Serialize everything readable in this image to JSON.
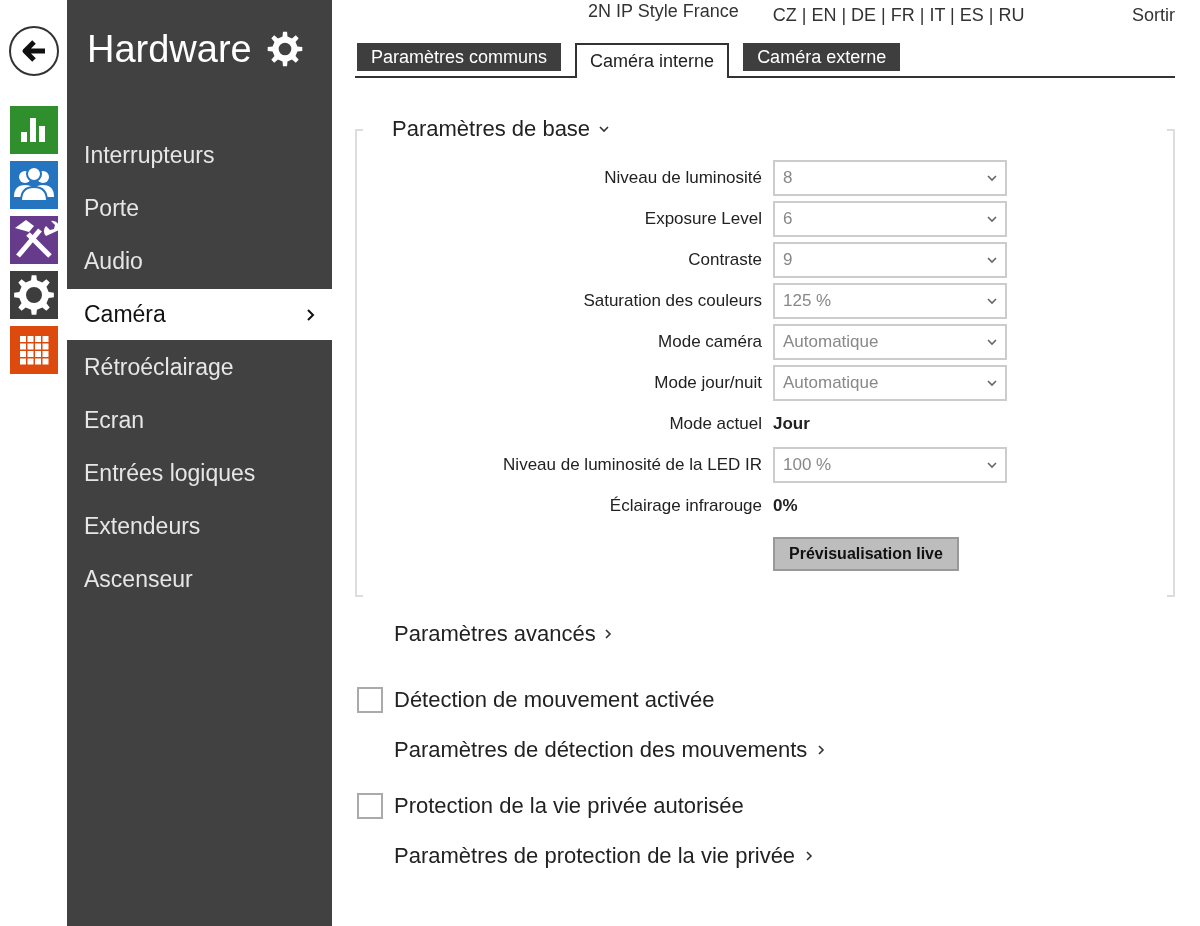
{
  "header": {
    "device_name": "2N IP Style France",
    "languages": "CZ | EN | DE | FR | IT | ES | RU",
    "logout": "Sortir"
  },
  "rail": [
    {
      "kind": "stats",
      "color": "#2f8f2c"
    },
    {
      "kind": "users",
      "color": "#2574c0"
    },
    {
      "kind": "tools",
      "color": "#663b8c"
    },
    {
      "kind": "gear",
      "color": "#3d3d3d"
    },
    {
      "kind": "grid",
      "color": "#dd4a0e"
    }
  ],
  "sidebar": {
    "title": "Hardware",
    "items": [
      {
        "label": "Interrupteurs",
        "selected": false
      },
      {
        "label": "Porte",
        "selected": false
      },
      {
        "label": "Audio",
        "selected": false
      },
      {
        "label": "Caméra",
        "selected": true
      },
      {
        "label": "Rétroéclairage",
        "selected": false
      },
      {
        "label": "Ecran",
        "selected": false
      },
      {
        "label": "Entrées logiques",
        "selected": false
      },
      {
        "label": "Extendeurs",
        "selected": false
      },
      {
        "label": "Ascenseur",
        "selected": false
      }
    ]
  },
  "tabs": [
    {
      "label": "Paramètres communs",
      "selected": false
    },
    {
      "label": "Caméra interne",
      "selected": true
    },
    {
      "label": "Caméra externe",
      "selected": false
    }
  ],
  "sections": [
    {
      "title": "Paramètres de base",
      "expanded": true,
      "fields": [
        {
          "kind": "select",
          "label": "Niveau de luminosité",
          "value": "8"
        },
        {
          "kind": "select",
          "label": "Exposure Level",
          "value": "6"
        },
        {
          "kind": "select",
          "label": "Contraste",
          "value": "9"
        },
        {
          "kind": "select",
          "label": "Saturation des couleurs",
          "value": "125 %"
        },
        {
          "kind": "select",
          "label": "Mode caméra",
          "value": "Automatique"
        },
        {
          "kind": "select",
          "label": "Mode jour/nuit",
          "value": "Automatique"
        },
        {
          "kind": "text",
          "label": "Mode actuel",
          "value": "Jour"
        },
        {
          "kind": "select",
          "label": "Niveau de luminosité de la LED IR",
          "value": "100 %"
        },
        {
          "kind": "text",
          "label": "Éclairage infrarouge",
          "value": "0%"
        },
        {
          "kind": "button",
          "label": "Prévisualisation live"
        }
      ]
    },
    {
      "title": "Paramètres avancés",
      "expanded": false
    }
  ],
  "options": [
    {
      "label": "Détection de mouvement activée",
      "checked": false,
      "link": "Paramètres de détection des mouvements"
    },
    {
      "label": "Protection de la vie privée autorisée",
      "checked": false,
      "link": "Paramètres de protection de la vie privée"
    }
  ]
}
